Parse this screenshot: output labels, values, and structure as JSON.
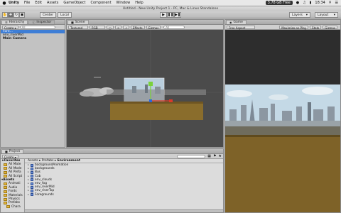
{
  "menubar": {
    "apple": "",
    "items": [
      "Unity",
      "File",
      "Edit",
      "Assets",
      "GameObject",
      "Component",
      "Window",
      "Help"
    ],
    "free_space": "3.78 GB Free",
    "time": "18:34"
  },
  "window": {
    "title": "Untitled - New Unity Project 1 - PC, Mac & Linux Standalone"
  },
  "toolbar": {
    "pivot_center": "Center",
    "pivot_local": "Local",
    "layers": "Layers",
    "layout": "Layout"
  },
  "hierarchy": {
    "tab_hierarchy": "Hierarchy",
    "tab_inspector": "Inspector",
    "create": "Create",
    "search_placeholder": "All",
    "items": [
      "Fore...",
      "env_riverMid",
      "Main Camera"
    ]
  },
  "scene": {
    "tab": "Scene",
    "draw_mode": "Textured",
    "render_mode": "RGB",
    "effects": "Effects",
    "gizmos": "Gizmos",
    "search_placeholder": "All"
  },
  "game": {
    "tab": "Game",
    "aspect": "Free Aspect",
    "maximize": "Maximize on Play",
    "stats": "Stats",
    "gizmos": "Gizmos"
  },
  "project": {
    "tab": "Project",
    "create": "Create",
    "tree": [
      {
        "label": "Favorites",
        "level": 0
      },
      {
        "label": "All Mate",
        "level": 1
      },
      {
        "label": "All Mode",
        "level": 1
      },
      {
        "label": "All Prefa",
        "level": 1
      },
      {
        "label": "All Script",
        "level": 1
      },
      {
        "label": "Assets",
        "level": 0
      },
      {
        "label": "Animati",
        "level": 1
      },
      {
        "label": "Audio",
        "level": 1
      },
      {
        "label": "Fonts",
        "level": 1
      },
      {
        "label": "Materials",
        "level": 1
      },
      {
        "label": "Physics",
        "level": 1
      },
      {
        "label": "Prefabs",
        "level": 1
      },
      {
        "label": "Chara",
        "level": 2
      }
    ],
    "breadcrumb": [
      "Assets",
      "Prefabs",
      "Environment"
    ],
    "assets": [
      "backgroundAnimation",
      "backgrounds",
      "Bus",
      "Cab",
      "env_clouds",
      "env_fog",
      "env_riverMid",
      "env_riverTop",
      "Foregrounds"
    ]
  },
  "colors": {
    "scene_bg": "#4b4b4b",
    "selection": "#3e7ed6",
    "folder": "#e3b63c"
  }
}
